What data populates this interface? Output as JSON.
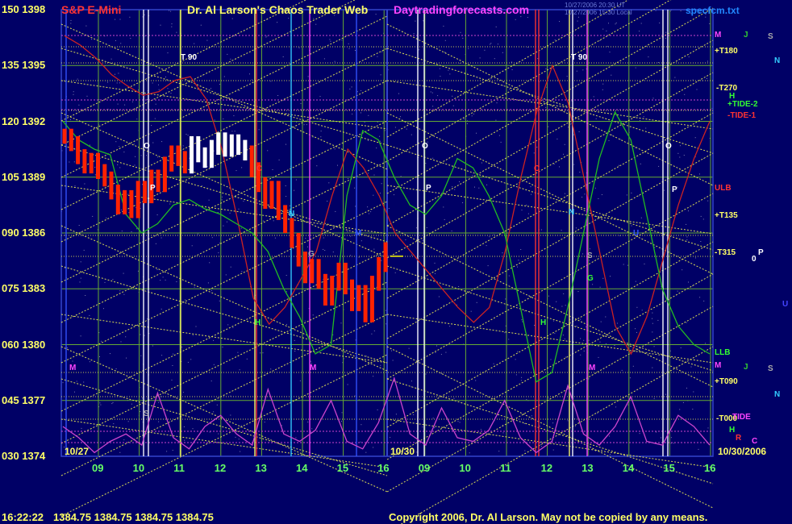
{
  "header": {
    "instrument": "S&P E-Mini",
    "title": "Dr. Al Larson's Chaos Trader Web",
    "site": "Daytradingforecasts.com",
    "file": "specfcm.txt",
    "update_line1": "10/27/2006 20:30 UT",
    "update_line2": "10/27/2006 15:30 Local"
  },
  "footer": {
    "time": "16:22:22",
    "quote": "1384.75 1384.75 1384.75 1384.75",
    "copyright": "Copyright 2006, Dr. Al Larson. May not be copied by any means."
  },
  "colors": {
    "background": "#000066",
    "price_bar": "#ff2200",
    "price_bar_fast": "#ffffff",
    "tide": "#cc2222",
    "music": "#22bb22",
    "power": "#cc44cc",
    "grid": "#66aa33",
    "fan_lines": "#dddd55",
    "markers": "#8888ff"
  },
  "chart_data": {
    "type": "line",
    "y_axis": {
      "osc_labels": [
        "150",
        "135",
        "120",
        "105",
        "090",
        "075",
        "060",
        "045",
        "030"
      ],
      "price_labels": [
        "1398",
        "1395",
        "1392",
        "1389",
        "1386",
        "1383",
        "1380",
        "1377",
        "1374"
      ],
      "price_range": [
        1374,
        1398
      ]
    },
    "x_axis": {
      "tick_labels": [
        "09",
        "10",
        "11",
        "12",
        "13",
        "14",
        "15",
        "16",
        "09",
        "10",
        "11",
        "12",
        "13",
        "14",
        "15",
        "16"
      ],
      "session_dates": [
        "10/27",
        "10/30"
      ],
      "forecast_date": "10/30/2006"
    },
    "right_labels": [
      {
        "text": "M",
        "color": "#ff44ff"
      },
      {
        "text": "J",
        "color": "#33cc33"
      },
      {
        "text": "S",
        "color": "#aaaaaa"
      },
      {
        "text": "N",
        "color": "#33ccff"
      },
      {
        "text": "+T180",
        "color": "#ffff66"
      },
      {
        "text": "-T270",
        "color": "#ffff66"
      },
      {
        "text": "+TIDE-2",
        "color": "#33ff33"
      },
      {
        "text": "-TIDE-1",
        "color": "#ff3333"
      },
      {
        "text": "H",
        "color": "#33ff33"
      },
      {
        "text": "ULB",
        "color": "#ff3333"
      },
      {
        "text": "+T135",
        "color": "#ffff66"
      },
      {
        "text": "-T315",
        "color": "#ffff66"
      },
      {
        "text": "P",
        "color": "#ffffff"
      },
      {
        "text": "0",
        "color": "#ffffff"
      },
      {
        "text": "U",
        "color": "#4444ff"
      },
      {
        "text": "LLB",
        "color": "#33ff33"
      },
      {
        "text": "M",
        "color": "#ff44ff"
      },
      {
        "text": "J",
        "color": "#33cc33"
      },
      {
        "text": "S",
        "color": "#aaaaaa"
      },
      {
        "text": "+T090",
        "color": "#ffff66"
      },
      {
        "text": "N",
        "color": "#33ccff"
      },
      {
        "text": "-T000",
        "color": "#ffff66"
      },
      {
        "text": "TIDE",
        "color": "#ff44ff"
      },
      {
        "text": "H",
        "color": "#33ff33"
      },
      {
        "text": "R",
        "color": "#ff3333"
      },
      {
        "text": "C",
        "color": "#ff44ff"
      }
    ],
    "annotations": [
      "T 90",
      "T 90",
      "O",
      "P",
      "C",
      "N",
      "M",
      "G",
      "H",
      "O",
      "P",
      "C",
      "N",
      "U",
      "S",
      "G",
      "H",
      "M",
      "O",
      "P",
      "M",
      "M",
      "S"
    ],
    "series": [
      {
        "name": "price",
        "values": [
          1391.2,
          1390.8,
          1390.1,
          1389.6,
          1389.9,
          1389.3,
          1388.9,
          1388.2,
          1387.4,
          1387.9,
          1387.2,
          1388.4,
          1388.0,
          1389.0,
          1388.6,
          1389.7,
          1390.3,
          1390.0,
          1389.6,
          1390.8,
          1390.2,
          1389.9,
          1390.6,
          1391.0,
          1390.5,
          1390.9,
          1390.6,
          1390.3,
          1389.4,
          1388.6,
          1387.7,
          1388.4,
          1387.1,
          1386.4,
          1385.6,
          1384.6,
          1383.7,
          1384.2,
          1383.4,
          1382.5,
          1383.3,
          1384.0,
          1383.1,
          1382.2,
          1382.8,
          1381.6,
          1383.3,
          1384.3,
          1385.1
        ]
      },
      {
        "name": "tide",
        "values": [
          1396.6,
          1396.1,
          1395.4,
          1394.5,
          1393.9,
          1393.4,
          1393.6,
          1394.2,
          1394.4,
          1393.2,
          1390.5,
          1386.7,
          1382.5,
          1381.1,
          1382.0,
          1383.5,
          1385.0,
          1388.0,
          1390.5,
          1389.5,
          1388.0,
          1386.0,
          1385.0,
          1384.0,
          1383.0,
          1382.0,
          1381.2,
          1382.0,
          1385.0,
          1389.0,
          1392.5,
          1395.0,
          1393.0,
          1389.0,
          1385.0,
          1381.0,
          1379.5,
          1381.5,
          1384.5,
          1387.5,
          1390.0,
          1392.0
        ]
      },
      {
        "name": "music",
        "values": [
          1392.0,
          1391.0,
          1390.5,
          1390.2,
          1387.0,
          1386.0,
          1386.5,
          1387.5,
          1387.8,
          1387.3,
          1387.0,
          1386.5,
          1386.0,
          1385.0,
          1383.0,
          1381.5,
          1379.5,
          1380.0,
          1388.0,
          1391.5,
          1391.0,
          1389.0,
          1387.5,
          1387.0,
          1388.0,
          1390.0,
          1389.5,
          1388.0,
          1386.0,
          1382.0,
          1378.0,
          1378.5,
          1382.0,
          1386.0,
          1390.0,
          1392.5,
          1391.0,
          1387.0,
          1383.0,
          1381.0,
          1380.0,
          1379.5
        ]
      },
      {
        "name": "power",
        "values": [
          38,
          35,
          31,
          34,
          36,
          33,
          47,
          35,
          32,
          38,
          41,
          36,
          33,
          48,
          36,
          34,
          37,
          45,
          34,
          32,
          39,
          51,
          36,
          33,
          43,
          35,
          34,
          37,
          45,
          35,
          31,
          34,
          49,
          36,
          33,
          38,
          46,
          34,
          33,
          41,
          38,
          33
        ]
      }
    ]
  }
}
